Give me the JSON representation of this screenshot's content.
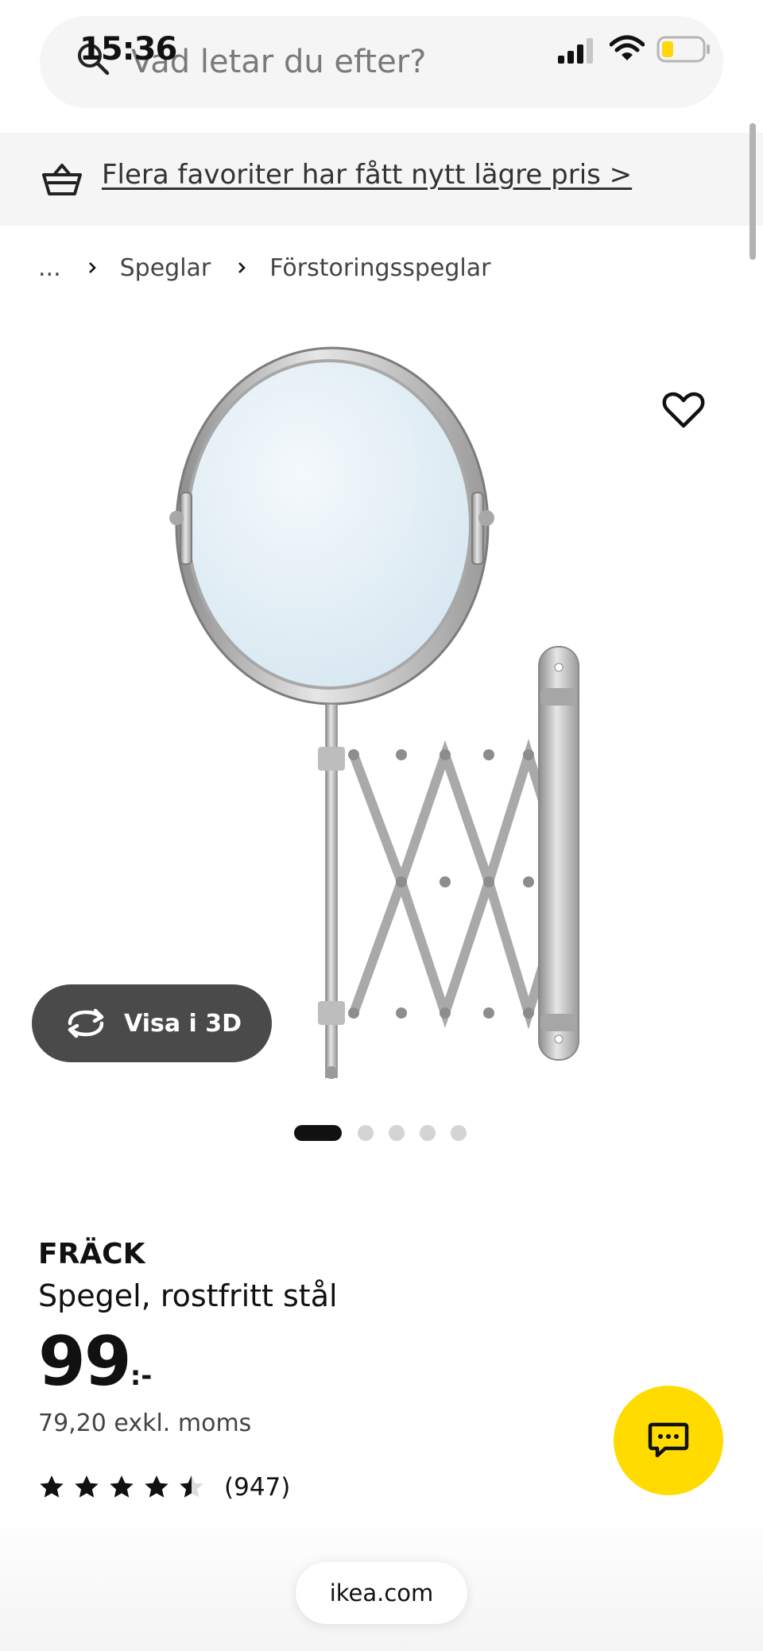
{
  "status_bar": {
    "time": "15:36"
  },
  "search": {
    "placeholder": "Vad letar du efter?"
  },
  "promo": {
    "link_text": "Flera favoriter har fått nytt lägre pris >"
  },
  "breadcrumb": {
    "items": [
      "...",
      "Speglar",
      "Förstoringsspeglar"
    ]
  },
  "gallery": {
    "view_3d_label": "Visa i 3D",
    "dot_count": 5,
    "active_dot": 0
  },
  "product": {
    "name": "FRÄCK",
    "description": "Spegel, rostfritt stål",
    "price_main": "99",
    "price_suffix": ":-",
    "price_excl_vat": "79,20 exkl. moms",
    "rating_value": 4.5,
    "rating_max": 5,
    "review_count": "(947)"
  },
  "browser": {
    "url": "ikea.com"
  },
  "colors": {
    "chat_button": "#ffdb00",
    "banner_bg": "#f5f5f5",
    "button_dark": "#4a4a4a",
    "battery_fill": "#ffd60a"
  }
}
